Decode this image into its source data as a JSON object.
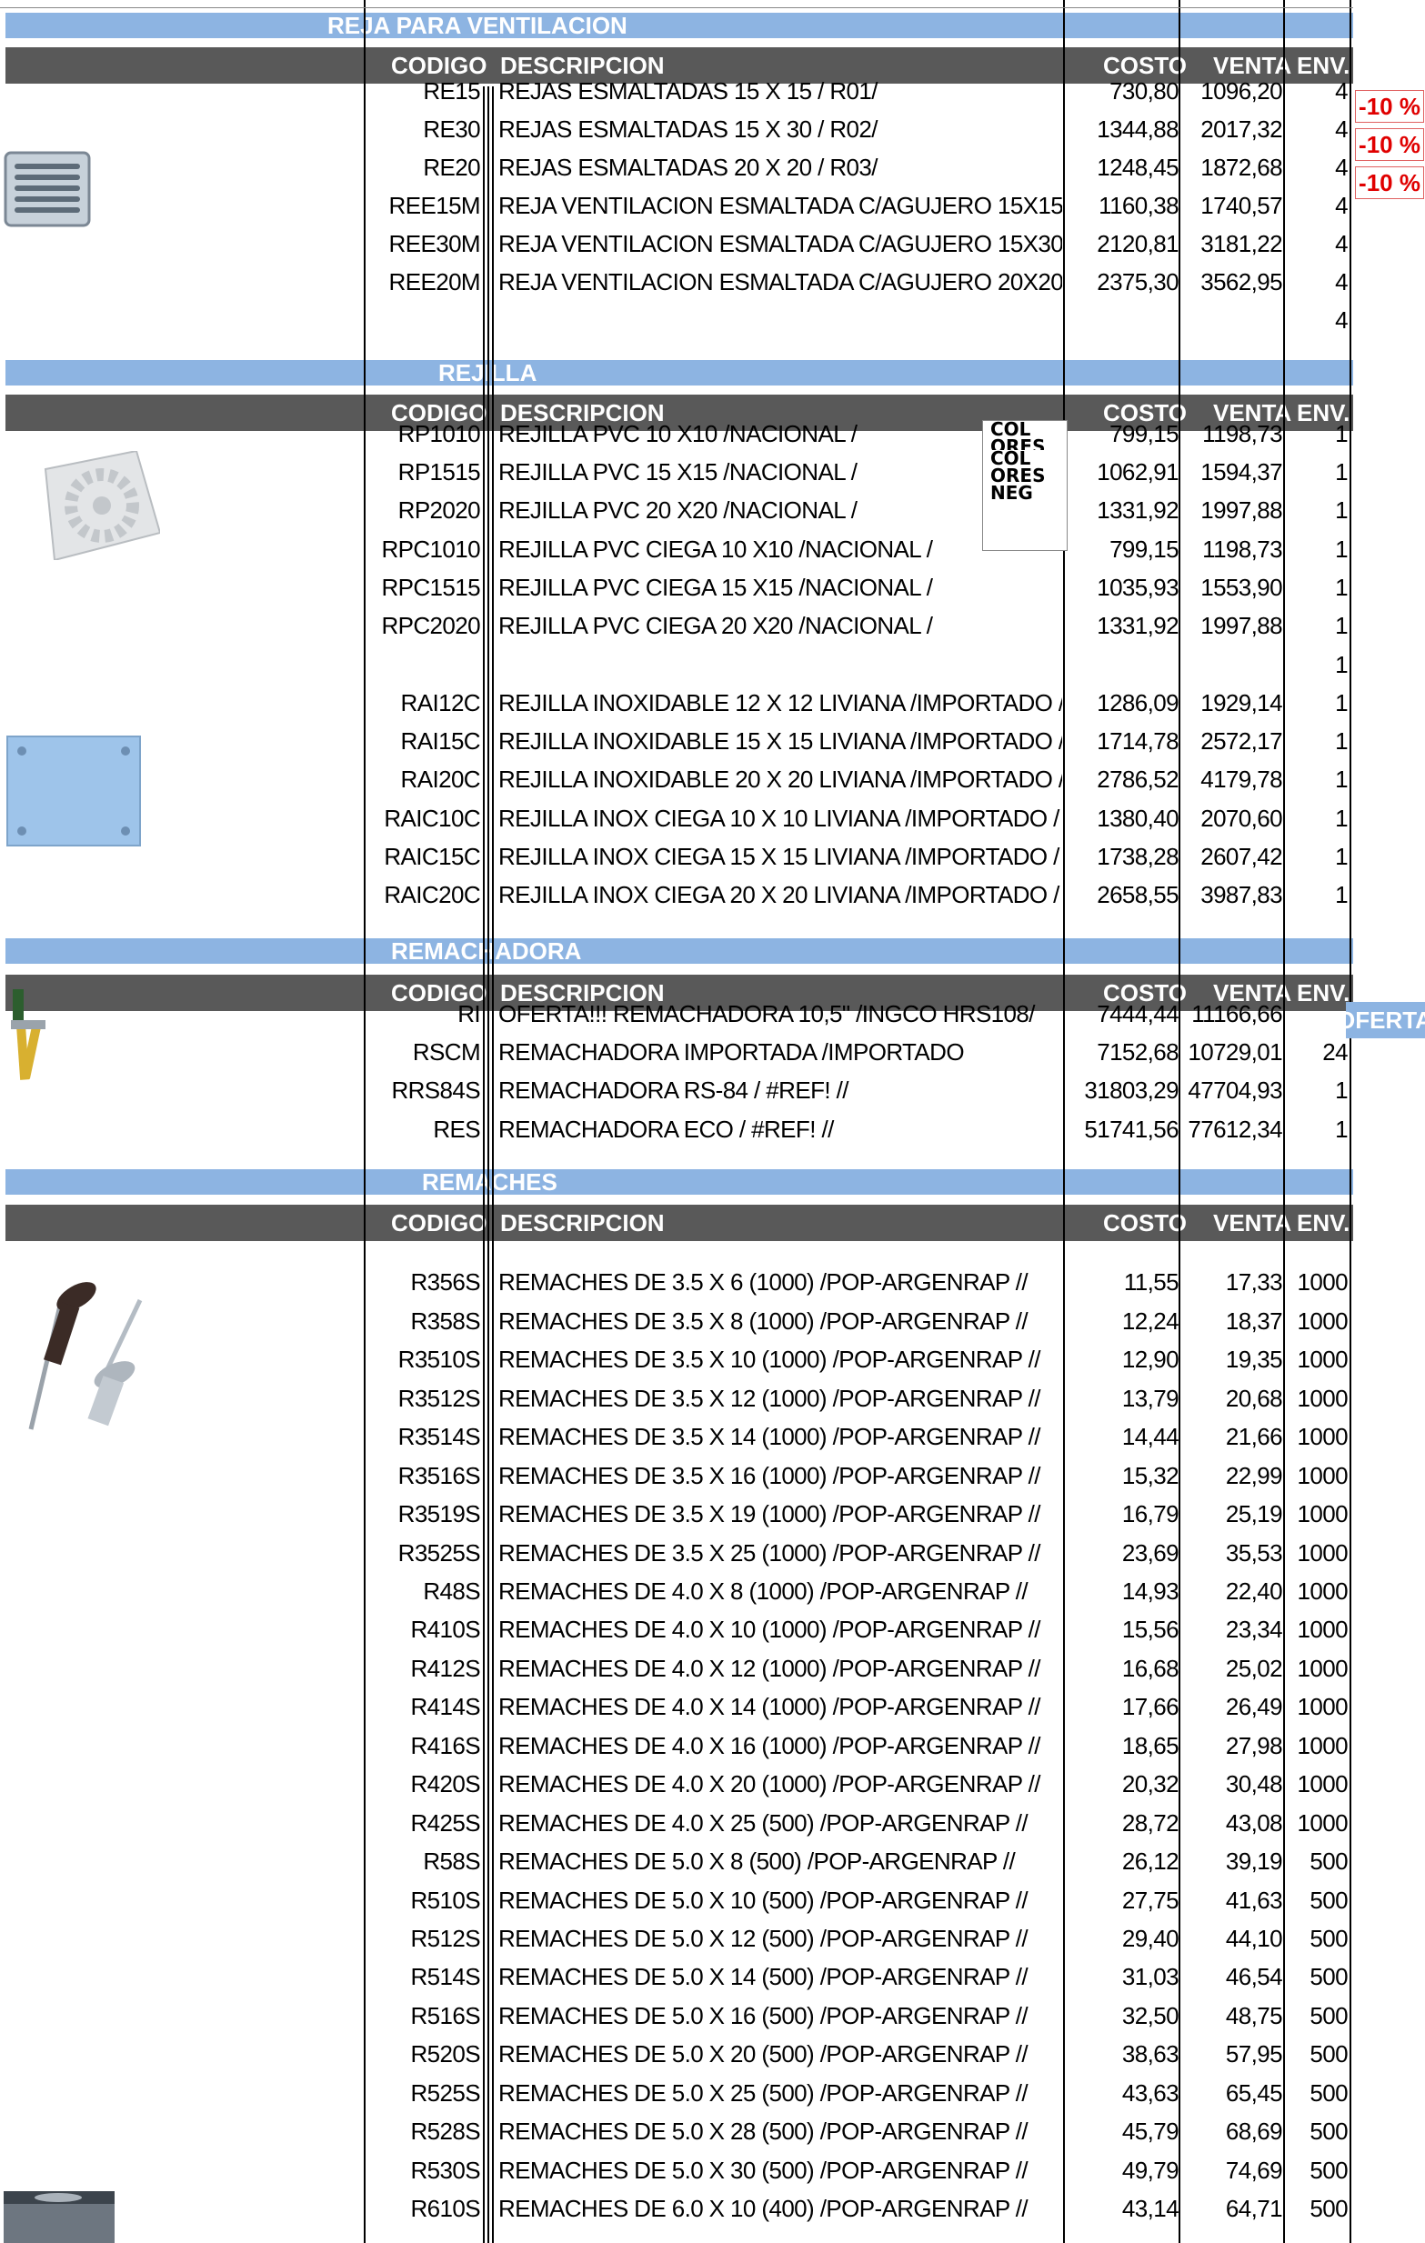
{
  "sections": {
    "reja": {
      "title": "REJA PARA VENTILACION",
      "header": {
        "codigo": "CODIGO",
        "descripcion": "DESCRIPCION",
        "costo": "COSTO",
        "venta": "VENTA",
        "env": "ENV."
      },
      "rows": [
        {
          "code": "RE15",
          "desc": "REJAS ESMALTADAS 15 X 15 / R01/",
          "costo": "730,80",
          "venta": "1096,20",
          "env": "4"
        },
        {
          "code": "RE30",
          "desc": "REJAS ESMALTADAS 15 X 30 / R02/",
          "costo": "1344,88",
          "venta": "2017,32",
          "env": "4"
        },
        {
          "code": "RE20",
          "desc": "REJAS ESMALTADAS 20 X 20 / R03/",
          "costo": "1248,45",
          "venta": "1872,68",
          "env": "4"
        },
        {
          "code": "REE15M",
          "desc": "REJA VENTILACION ESMALTADA C/AGUJERO 15X15 //",
          "costo": "1160,38",
          "venta": "1740,57",
          "env": "4"
        },
        {
          "code": "REE30M",
          "desc": "REJA VENTILACION ESMALTADA C/AGUJERO 15X30 //",
          "costo": "2120,81",
          "venta": "3181,22",
          "env": "4"
        },
        {
          "code": "REE20M",
          "desc": "REJA VENTILACION ESMALTADA C/AGUJERO 20X20 //",
          "costo": "2375,30",
          "venta": "3562,95",
          "env": "4"
        },
        {
          "code": "",
          "desc": "",
          "costo": "",
          "venta": "",
          "env": "4"
        }
      ],
      "badges": [
        "-10 %",
        "-10 %",
        "-10 %"
      ]
    },
    "rejilla": {
      "title": "REJILLA",
      "header": {
        "codigo": "CODIGO",
        "descripcion": "DESCRIPCION",
        "costo": "COSTO",
        "venta": "VENTA",
        "env": "ENV."
      },
      "rows": [
        {
          "code": "RP1010",
          "desc": "REJILLA PVC 10 X10 /NACIONAL /",
          "costo": "799,15",
          "venta": "1198,73",
          "env": "1"
        },
        {
          "code": "RP1515",
          "desc": "REJILLA PVC 15 X15 /NACIONAL /",
          "costo": "1062,91",
          "venta": "1594,37",
          "env": "1"
        },
        {
          "code": "RP2020",
          "desc": "REJILLA PVC 20 X20 /NACIONAL /",
          "costo": "1331,92",
          "venta": "1997,88",
          "env": "1"
        },
        {
          "code": "RPC1010",
          "desc": "REJILLA PVC CIEGA 10 X10 /NACIONAL /",
          "costo": "799,15",
          "venta": "1198,73",
          "env": "1"
        },
        {
          "code": "RPC1515",
          "desc": "REJILLA PVC CIEGA 15 X15 /NACIONAL /",
          "costo": "1035,93",
          "venta": "1553,90",
          "env": "1"
        },
        {
          "code": "RPC2020",
          "desc": "REJILLA PVC CIEGA 20 X20 /NACIONAL /",
          "costo": "1331,92",
          "venta": "1997,88",
          "env": "1"
        },
        {
          "code": "",
          "desc": "",
          "costo": "",
          "venta": "",
          "env": "1"
        },
        {
          "code": "RAI12C",
          "desc": "REJILLA INOXIDABLE 12 X 12 LIVIANA /IMPORTADO /",
          "costo": "1286,09",
          "venta": "1929,14",
          "env": "1"
        },
        {
          "code": "RAI15C",
          "desc": "REJILLA INOXIDABLE 15 X 15 LIVIANA /IMPORTADO /",
          "costo": "1714,78",
          "venta": "2572,17",
          "env": "1"
        },
        {
          "code": "RAI20C",
          "desc": "REJILLA INOXIDABLE 20 X 20 LIVIANA /IMPORTADO /",
          "costo": "2786,52",
          "venta": "4179,78",
          "env": "1"
        },
        {
          "code": "RAIC10C",
          "desc": "REJILLA INOX CIEGA 10 X 10 LIVIANA /IMPORTADO /",
          "costo": "1380,40",
          "venta": "2070,60",
          "env": "1"
        },
        {
          "code": "RAIC15C",
          "desc": "REJILLA INOX CIEGA 15 X 15 LIVIANA /IMPORTADO /",
          "costo": "1738,28",
          "venta": "2607,42",
          "env": "1"
        },
        {
          "code": "RAIC20C",
          "desc": "REJILLA INOX CIEGA 20 X 20 LIVIANA /IMPORTADO /",
          "costo": "2658,55",
          "venta": "3987,83",
          "env": "1"
        }
      ],
      "note": [
        "COL",
        "ORES",
        "COL",
        "ORES",
        "NEG"
      ]
    },
    "remachadora": {
      "title": "REMACHADORA",
      "header": {
        "codigo": "CODIGO",
        "descripcion": "DESCRIPCION",
        "costo": "COSTO",
        "venta": "VENTA",
        "env": "ENV."
      },
      "rows": [
        {
          "code": "RI",
          "desc": "OFERTA!!! REMACHADORA 10,5\" /INGCO HRS108/",
          "costo": "7444,44",
          "venta": "11166,66",
          "env": ""
        },
        {
          "code": "RSCM",
          "desc": "REMACHADORA IMPORTADA /IMPORTADO",
          "costo": "7152,68",
          "venta": "10729,01",
          "env": "24"
        },
        {
          "code": "RRS84S",
          "desc": "REMACHADORA RS-84 / #REF! //",
          "costo": "31803,29",
          "venta": "47704,93",
          "env": "1"
        },
        {
          "code": "RES",
          "desc": "REMACHADORA ECO / #REF! //",
          "costo": "51741,56",
          "venta": "77612,34",
          "env": "1"
        }
      ],
      "oferta": "OFERTA"
    },
    "remaches": {
      "title": "REMACHES",
      "header": {
        "codigo": "CODIGO",
        "descripcion": "DESCRIPCION",
        "costo": "COSTO",
        "venta": "VENTA",
        "env": "ENV."
      },
      "rows": [
        {
          "code": "R356S",
          "desc": "REMACHES DE 3.5 X 6 (1000) /POP-ARGENRAP //",
          "costo": "11,55",
          "venta": "17,33",
          "env": "1000"
        },
        {
          "code": "R358S",
          "desc": "REMACHES DE 3.5 X 8 (1000) /POP-ARGENRAP //",
          "costo": "12,24",
          "venta": "18,37",
          "env": "1000"
        },
        {
          "code": "R3510S",
          "desc": "REMACHES DE 3.5 X 10 (1000) /POP-ARGENRAP //",
          "costo": "12,90",
          "venta": "19,35",
          "env": "1000"
        },
        {
          "code": "R3512S",
          "desc": "REMACHES DE 3.5 X 12 (1000) /POP-ARGENRAP //",
          "costo": "13,79",
          "venta": "20,68",
          "env": "1000"
        },
        {
          "code": "R3514S",
          "desc": "REMACHES DE 3.5 X 14 (1000) /POP-ARGENRAP //",
          "costo": "14,44",
          "venta": "21,66",
          "env": "1000"
        },
        {
          "code": "R3516S",
          "desc": "REMACHES DE 3.5 X 16 (1000) /POP-ARGENRAP //",
          "costo": "15,32",
          "venta": "22,99",
          "env": "1000"
        },
        {
          "code": "R3519S",
          "desc": "REMACHES DE 3.5 X 19 (1000) /POP-ARGENRAP //",
          "costo": "16,79",
          "venta": "25,19",
          "env": "1000"
        },
        {
          "code": "R3525S",
          "desc": "REMACHES DE 3.5 X 25 (1000) /POP-ARGENRAP //",
          "costo": "23,69",
          "venta": "35,53",
          "env": "1000"
        },
        {
          "code": "R48S",
          "desc": "REMACHES DE 4.0 X 8 (1000) /POP-ARGENRAP //",
          "costo": "14,93",
          "venta": "22,40",
          "env": "1000"
        },
        {
          "code": "R410S",
          "desc": "REMACHES DE 4.0 X 10 (1000) /POP-ARGENRAP //",
          "costo": "15,56",
          "venta": "23,34",
          "env": "1000"
        },
        {
          "code": "R412S",
          "desc": "REMACHES DE 4.0 X 12 (1000) /POP-ARGENRAP //",
          "costo": "16,68",
          "venta": "25,02",
          "env": "1000"
        },
        {
          "code": "R414S",
          "desc": "REMACHES DE 4.0 X 14 (1000) /POP-ARGENRAP //",
          "costo": "17,66",
          "venta": "26,49",
          "env": "1000"
        },
        {
          "code": "R416S",
          "desc": "REMACHES DE 4.0 X 16 (1000) /POP-ARGENRAP //",
          "costo": "18,65",
          "venta": "27,98",
          "env": "1000"
        },
        {
          "code": "R420S",
          "desc": "REMACHES DE 4.0 X 20 (1000) /POP-ARGENRAP //",
          "costo": "20,32",
          "venta": "30,48",
          "env": "1000"
        },
        {
          "code": "R425S",
          "desc": "REMACHES DE 4.0 X 25 (500) /POP-ARGENRAP //",
          "costo": "28,72",
          "venta": "43,08",
          "env": "1000"
        },
        {
          "code": "R58S",
          "desc": "REMACHES DE 5.0 X 8 (500) /POP-ARGENRAP //",
          "costo": "26,12",
          "venta": "39,19",
          "env": "500"
        },
        {
          "code": "R510S",
          "desc": "REMACHES DE 5.0 X 10 (500) /POP-ARGENRAP //",
          "costo": "27,75",
          "venta": "41,63",
          "env": "500"
        },
        {
          "code": "R512S",
          "desc": "REMACHES DE 5.0 X 12 (500) /POP-ARGENRAP //",
          "costo": "29,40",
          "venta": "44,10",
          "env": "500"
        },
        {
          "code": "R514S",
          "desc": "REMACHES DE 5.0 X 14 (500) /POP-ARGENRAP //",
          "costo": "31,03",
          "venta": "46,54",
          "env": "500"
        },
        {
          "code": "R516S",
          "desc": "REMACHES DE 5.0 X 16 (500) /POP-ARGENRAP //",
          "costo": "32,50",
          "venta": "48,75",
          "env": "500"
        },
        {
          "code": "R520S",
          "desc": "REMACHES DE 5.0 X 20 (500) /POP-ARGENRAP //",
          "costo": "38,63",
          "venta": "57,95",
          "env": "500"
        },
        {
          "code": "R525S",
          "desc": "REMACHES DE 5.0 X 25 (500) /POP-ARGENRAP //",
          "costo": "43,63",
          "venta": "65,45",
          "env": "500"
        },
        {
          "code": "R528S",
          "desc": "REMACHES DE 5.0 X 28 (500) /POP-ARGENRAP //",
          "costo": "45,79",
          "venta": "68,69",
          "env": "500"
        },
        {
          "code": "R530S",
          "desc": "REMACHES DE 5.0 X 30 (500) /POP-ARGENRAP //",
          "costo": "49,79",
          "venta": "74,69",
          "env": "500"
        },
        {
          "code": "R610S",
          "desc": "REMACHES DE 6.0 X 10 (400) /POP-ARGENRAP //",
          "costo": "43,14",
          "venta": "64,71",
          "env": "500"
        }
      ]
    }
  },
  "colors": {
    "band": "#8db4e2",
    "header": "#595959",
    "badge_text": "#e00000"
  }
}
